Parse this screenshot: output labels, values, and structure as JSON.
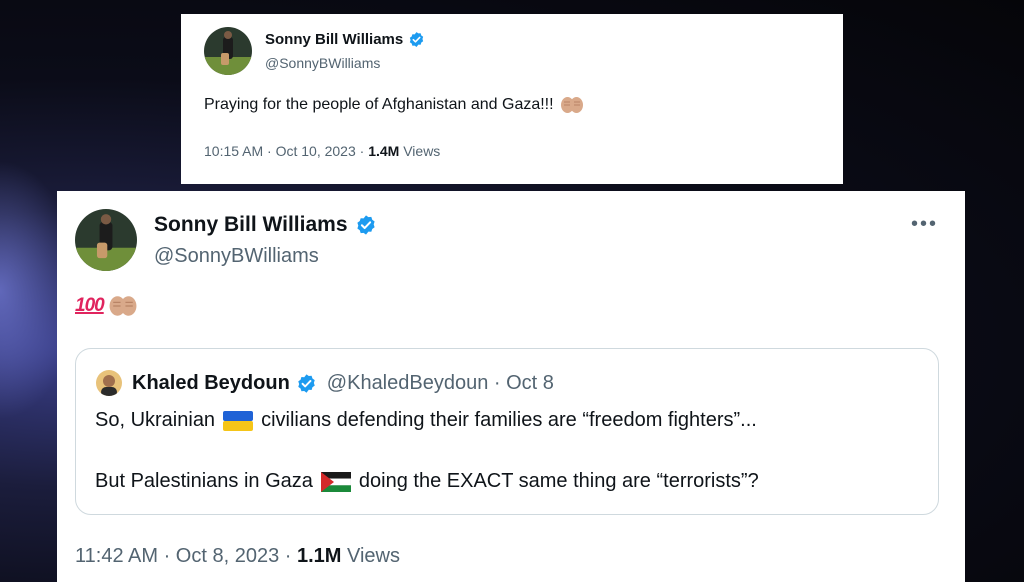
{
  "tweet_top": {
    "author_name": "Sonny Bill Williams",
    "author_handle": "@SonnyBWilliams",
    "text": "Praying for the people of Afghanistan and Gaza!!!",
    "time": "10:15 AM · Oct 10, 2023 · ",
    "views_count": "1.4M",
    "views_label": " Views"
  },
  "tweet_main": {
    "author_name": "Sonny Bill Williams",
    "author_handle": "@SonnyBWilliams",
    "more_label": "•••",
    "emoji_text": "100",
    "time": "11:42 AM · Oct 8, 2023 · ",
    "views_count": "1.1M",
    "views_label": " Views",
    "quote": {
      "author_name": "Khaled Beydoun",
      "author_handle_date": "@KhaledBeydoun · Oct 8",
      "line1_a": "So, Ukrainian",
      "line1_b": "civilians defending their families are “freedom fighters”...",
      "line2_a": "But Palestinians in Gaza",
      "line2_b": "doing the EXACT same thing are “terrorists”?"
    }
  },
  "colors": {
    "verified": "#1d9bf0",
    "text_primary": "#0f1419",
    "text_secondary": "#536471"
  },
  "icons": [
    "verified-badge-icon",
    "praying-hands-icon",
    "hundred-points-icon",
    "ukraine-flag-icon",
    "palestine-flag-icon",
    "more-options-icon"
  ]
}
